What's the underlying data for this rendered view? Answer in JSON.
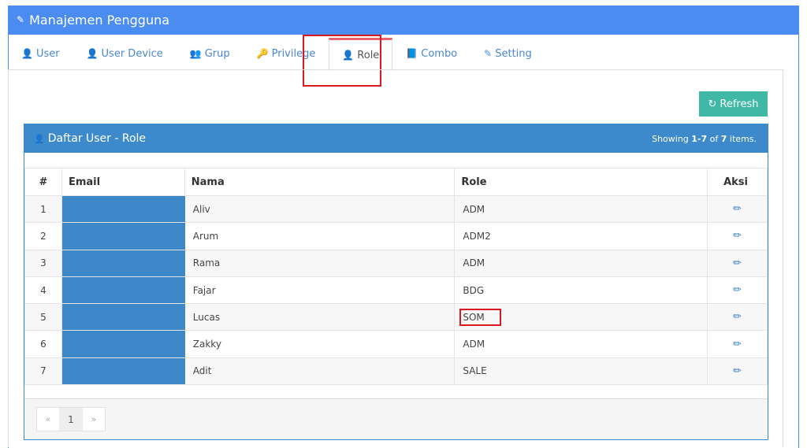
{
  "panel": {
    "title": "Manajemen Pengguna",
    "title_icon": "pencil-icon"
  },
  "tabs": [
    {
      "label": "User",
      "icon": "user-icon",
      "active": false
    },
    {
      "label": "User Device",
      "icon": "user-icon",
      "active": false
    },
    {
      "label": "Grup",
      "icon": "users-icon",
      "active": false
    },
    {
      "label": "Privilege",
      "icon": "key-icon",
      "active": false
    },
    {
      "label": "Role",
      "icon": "user-secret-icon",
      "active": true
    },
    {
      "label": "Combo",
      "icon": "book-icon",
      "active": false
    },
    {
      "label": "Setting",
      "icon": "edit-icon",
      "active": false
    }
  ],
  "toolbar": {
    "refresh_label": "Refresh",
    "refresh_icon": "refresh-icon"
  },
  "grid": {
    "title": "Daftar User - Role",
    "summary_prefix": "Showing ",
    "summary_range": "1-7",
    "summary_of": " of ",
    "summary_total": "7",
    "summary_suffix": " items.",
    "columns": [
      "#",
      "Email",
      "Nama",
      "Role",
      "Aksi"
    ],
    "rows": [
      {
        "no": "1",
        "email": "",
        "nama": "Aliv",
        "role": "ADM"
      },
      {
        "no": "2",
        "email": "",
        "nama": "Arum",
        "role": "ADM2"
      },
      {
        "no": "3",
        "email": "",
        "nama": "Rama",
        "role": "ADM"
      },
      {
        "no": "4",
        "email": "",
        "nama": "Fajar",
        "role": "BDG"
      },
      {
        "no": "5",
        "email": "",
        "nama": "Lucas",
        "role": "SOM"
      },
      {
        "no": "6",
        "email": "",
        "nama": "Zakky",
        "role": "ADM"
      },
      {
        "no": "7",
        "email": "",
        "nama": "Adit",
        "role": "SALE"
      }
    ],
    "action_icon": "pencil-icon"
  },
  "pagination": {
    "prev": "«",
    "current": "1",
    "next": "»"
  },
  "colors": {
    "header_blue": "#4a8cf0",
    "grid_blue": "#3c8acc",
    "refresh_teal": "#3fb8a6",
    "active_tab_accent": "#e8626a",
    "highlight_red": "#d9181f"
  }
}
